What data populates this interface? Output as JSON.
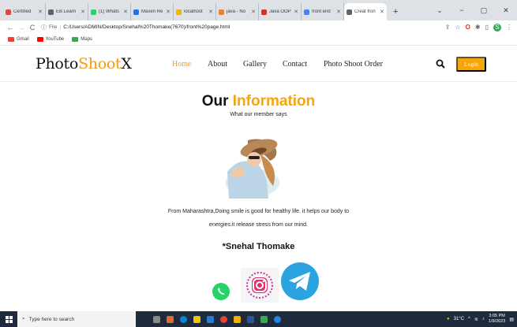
{
  "browser": {
    "tabs": [
      {
        "label": "Certified",
        "color": "#ea4335"
      },
      {
        "label": "EB Learn",
        "color": "#5f6368"
      },
      {
        "label": "(1) Whats",
        "color": "#25d366"
      },
      {
        "label": "Maven Re",
        "color": "#1a73e8"
      },
      {
        "label": "localhost",
        "color": "#f4b400"
      },
      {
        "label": "java - No",
        "color": "#f48024"
      },
      {
        "label": "Java OOP",
        "color": "#d93025"
      },
      {
        "label": "front end",
        "color": "#4285f4"
      },
      {
        "label": "Creat fron",
        "color": "#5f6368"
      }
    ],
    "active_tab_index": 8,
    "new_tab": "+",
    "window_controls": {
      "chevron": "⌄",
      "minimize": "−",
      "maximize": "▢",
      "close": "✕"
    },
    "address": {
      "protocol": "File",
      "url": "C:/Users/ADMIN/Desktop/Snehal%20Thomake(7670)/front%20page.html"
    },
    "profile_initial": "S",
    "bookmarks": [
      {
        "label": "Gmail",
        "color": "#ea4335"
      },
      {
        "label": "YouTube",
        "color": "#ff0000"
      },
      {
        "label": "Maps",
        "color": "#34a853"
      }
    ]
  },
  "site": {
    "logo": {
      "part1": "Photo",
      "part2": "Shoot",
      "part3": "X"
    },
    "menu": {
      "home": "Home",
      "about": "About",
      "gallery": "Gallery",
      "contact": "Contact",
      "order": "Photo Shoot Order"
    },
    "login": "Login",
    "headline": {
      "part1": "Our ",
      "part2": "Information"
    },
    "subheading": "What our member says",
    "quote_line1": "From Maharashtra,Doing smile is good for healthy life. it helps our body to",
    "quote_line2": "energies.it release stress from our mind.",
    "member_name": "*Snehal Thomake",
    "colors": {
      "accent": "#f5a50d"
    }
  },
  "taskbar": {
    "search_placeholder": "Type here to search",
    "weather": "31°C",
    "time": "3:05 PM",
    "date": "1/9/2023"
  }
}
